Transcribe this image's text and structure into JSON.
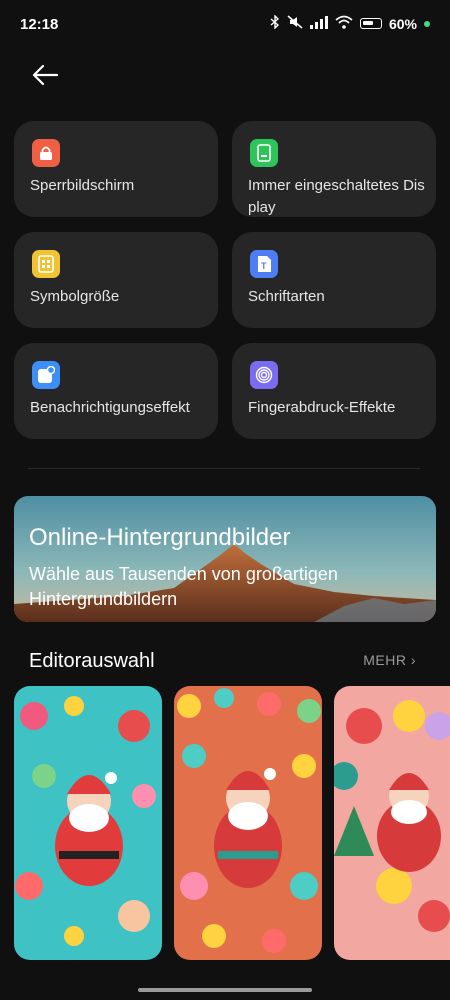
{
  "status_bar": {
    "time": "12:18",
    "battery_text": "60%",
    "icons": [
      "bluetooth-icon",
      "mute-icon",
      "signal-icon",
      "wifi-icon",
      "battery-icon"
    ]
  },
  "tiles": [
    {
      "label": "Sperrbildschirm",
      "icon": "lock-icon",
      "color": "#ef5f43"
    },
    {
      "label": "Immer eingeschaltetes Display",
      "icon": "aod-icon",
      "color": "#2ec35b"
    },
    {
      "label": "Symbolgröße",
      "icon": "icon-size-icon",
      "color": "#f1c232"
    },
    {
      "label": "Schriftarten",
      "icon": "font-icon",
      "color": "#4f7ef4"
    },
    {
      "label": "Benachrichtigungseffekt",
      "icon": "notification-icon",
      "color": "#3d8ef7"
    },
    {
      "label": "Fingerabdruck-Effekte",
      "icon": "fingerprint-icon",
      "color": "#7a6cf0"
    }
  ],
  "banner": {
    "title": "Online-Hintergrundbilder",
    "subtitle": "Wähle aus Tausenden von großartigen Hintergrundbildern"
  },
  "editor": {
    "title": "Editorauswahl",
    "more": "MEHR"
  },
  "wallpapers": [
    "wallpaper-santa-teal",
    "wallpaper-santa-candy",
    "wallpaper-santa-ornaments"
  ]
}
